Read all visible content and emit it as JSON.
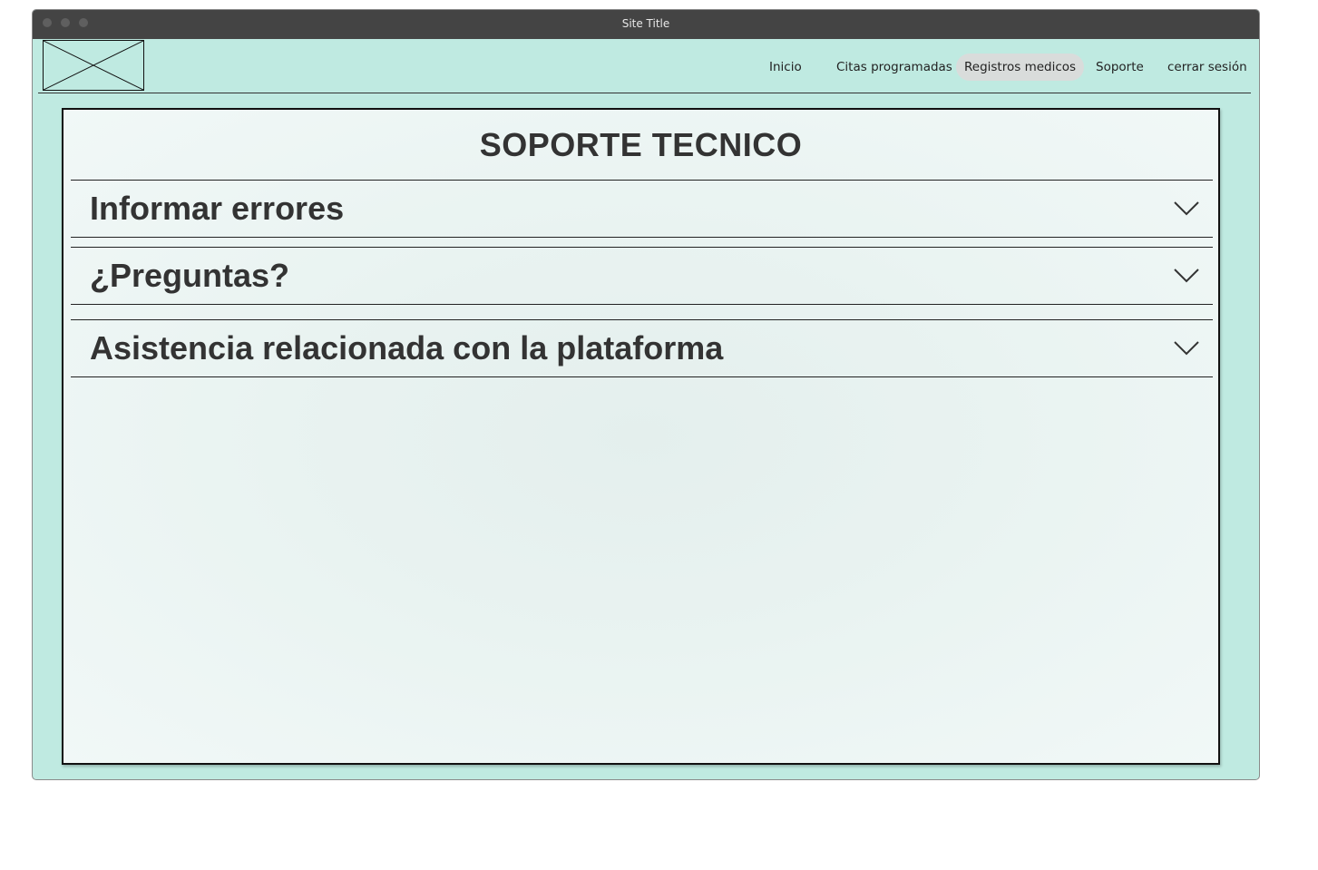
{
  "window": {
    "title": "Site Title"
  },
  "header": {
    "logo_icon": "image-placeholder-icon",
    "nav": [
      {
        "label": "Inicio"
      },
      {
        "label": "Citas programadas"
      },
      {
        "label": "Registros medicos",
        "active": true
      },
      {
        "label": "Soporte"
      },
      {
        "label": "cerrar sesión"
      }
    ]
  },
  "main": {
    "title": "SOPORTE TECNICO",
    "sections": [
      {
        "label": "Informar errores",
        "icon": "chevron-down-icon"
      },
      {
        "label": "¿Preguntas?",
        "icon": "chevron-down-icon"
      },
      {
        "label": "Asistencia relacionada con la plataforma",
        "icon": "chevron-down-icon"
      }
    ]
  },
  "colors": {
    "background": "#bfeae1",
    "titlebar": "#444444",
    "active_nav": "#d9dcdb",
    "text": "#333333"
  }
}
